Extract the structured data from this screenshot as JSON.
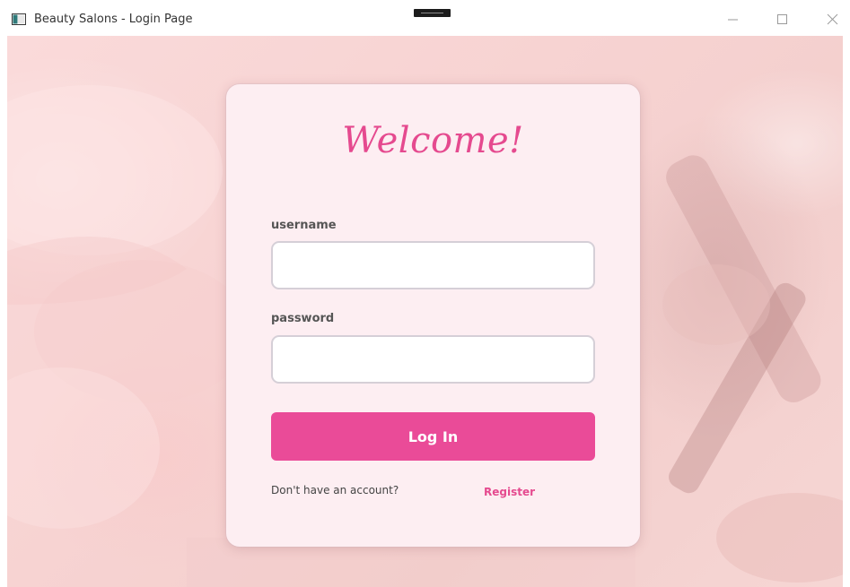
{
  "window": {
    "title": "Beauty Salons - Login Page",
    "icons": [
      "app-icon",
      "minimize-icon",
      "maximize-icon",
      "close-icon"
    ]
  },
  "login": {
    "heading": "Welcome!",
    "username_label": "username",
    "username_value": "",
    "password_label": "password",
    "password_value": "",
    "login_button": "Log In",
    "no_account_text": "Don't have an account?",
    "register_link": "Register"
  },
  "colors": {
    "accent": "#ea4b98",
    "heading": "#e54a8f",
    "card": "#fdeef2",
    "background": "#f7d3d2"
  }
}
